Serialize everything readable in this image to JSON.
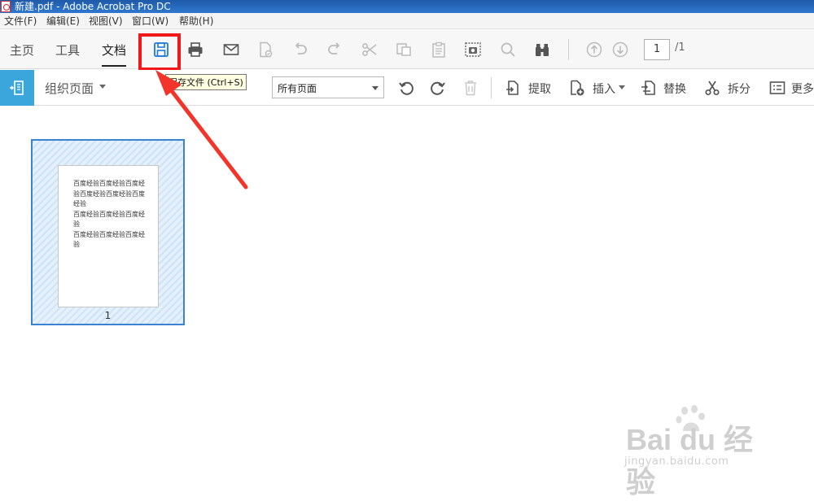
{
  "window": {
    "title": "新建.pdf - Adobe Acrobat Pro DC"
  },
  "menu": [
    "文件(F)",
    "编辑(E)",
    "视图(V)",
    "窗口(W)",
    "帮助(H)"
  ],
  "tabs": [
    {
      "label": "主页",
      "active": false
    },
    {
      "label": "工具",
      "active": false
    },
    {
      "label": "文档",
      "active": true
    }
  ],
  "toolbar": {
    "icons": [
      "save-icon",
      "print-icon",
      "mail-icon",
      "sign-icon",
      "undo-icon",
      "redo-icon",
      "cut-icon",
      "copy-icon",
      "paste-icon",
      "snapshot-icon",
      "search-icon",
      "binoculars-icon",
      "page-up-icon",
      "page-down-icon"
    ],
    "current_page": "1",
    "total_pages": "/1",
    "tooltip": "保存文件 (Ctrl+S)"
  },
  "organize": {
    "title": "组织页面",
    "page_range": "所有页面",
    "actions": [
      {
        "label": "提取",
        "icon": "extract-icon"
      },
      {
        "label": "插入",
        "icon": "insert-icon"
      },
      {
        "label": "替换",
        "icon": "replace-icon"
      },
      {
        "label": "拆分",
        "icon": "split-icon"
      },
      {
        "label": "更多",
        "icon": "more-icon"
      }
    ]
  },
  "thumbnail": {
    "lines": [
      "百度经验百度经验百度经验百度经验百度经验百度经验",
      "百度经验百度经验百度经验",
      "百度经验百度经验百度经验"
    ],
    "page_number": "1"
  },
  "watermark": {
    "main": "Bai du 经验",
    "sub": "jingyan.baidu.com"
  },
  "colors": {
    "accent": "#3aa6db",
    "highlight": "#f01818",
    "selection": "#3b82d0"
  }
}
